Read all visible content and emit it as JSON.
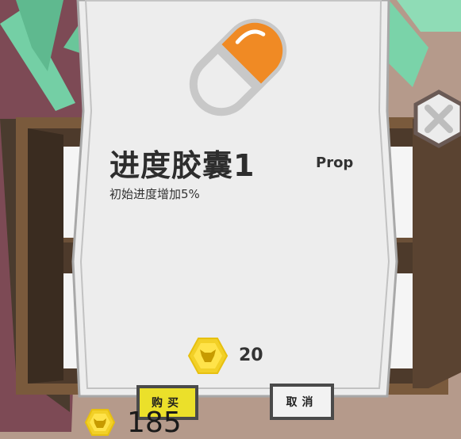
{
  "item": {
    "name": "进度胶囊1",
    "type_tag": "Prop",
    "description": "初始进度增加5%",
    "price": "20",
    "icon": "capsule-pill-icon"
  },
  "buttons": {
    "buy_label": "购买",
    "cancel_label": "取消",
    "close_icon": "close-x-icon"
  },
  "player": {
    "coins": "185",
    "currency_icon": "hexagon-bull-coin-icon"
  },
  "colors": {
    "background": "#b59a8b",
    "card": "#ededed",
    "buy_button": "#ebe02a",
    "coin": "#f2d027",
    "capsule_orange": "#f08a24",
    "capsule_gray": "#c8c8c8"
  }
}
